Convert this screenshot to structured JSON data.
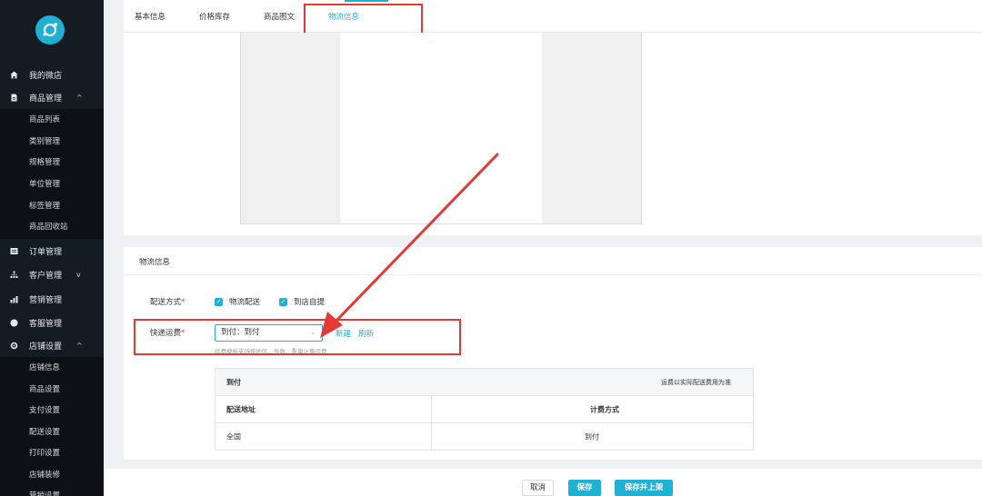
{
  "sidebar": {
    "items": [
      {
        "label": "我的微店",
        "icon": "home-icon"
      },
      {
        "label": "商品管理",
        "icon": "document-icon",
        "expanded": true
      },
      {
        "label": "订单管理",
        "icon": "list-icon"
      },
      {
        "label": "客户管理",
        "icon": "users-icon",
        "expanded": false
      },
      {
        "label": "营销管理",
        "icon": "chart-icon"
      },
      {
        "label": "客服管理",
        "icon": "chat-icon"
      },
      {
        "label": "店铺设置",
        "icon": "gear-icon",
        "expanded": true
      }
    ],
    "product_sub": [
      "商品列表",
      "类别管理",
      "规格管理",
      "单位管理",
      "标签管理",
      "商品回收站"
    ],
    "store_sub": [
      "店铺信息",
      "商品设置",
      "支付设置",
      "配送设置",
      "打印设置",
      "店铺装修",
      "营销设置"
    ]
  },
  "tabs": [
    "基本信息",
    "价格库存",
    "商品图文",
    "物流信息"
  ],
  "active_tab": 3,
  "logistics": {
    "title": "物流信息",
    "delivery_label": "配送方式",
    "delivery_options": [
      "物流配送",
      "到店自提"
    ],
    "freight_label": "快递运费",
    "freight_value": "到付：到付",
    "new_link": "新建",
    "refresh_link": "刷新",
    "hint": "运费模板支持按地区、件数、重量计算运费",
    "table": {
      "name": "到付",
      "note": "运费以实际配送费用为准",
      "headers": [
        "配送地址",
        "计费方式"
      ],
      "rows": [
        [
          "全国",
          "到付"
        ]
      ]
    }
  },
  "footer": {
    "cancel": "取消",
    "save": "保存",
    "save_publish": "保存并上架"
  },
  "colors": {
    "accent": "#1fb1d4",
    "sidebar": "#141b22",
    "highlight": "#e53935"
  }
}
